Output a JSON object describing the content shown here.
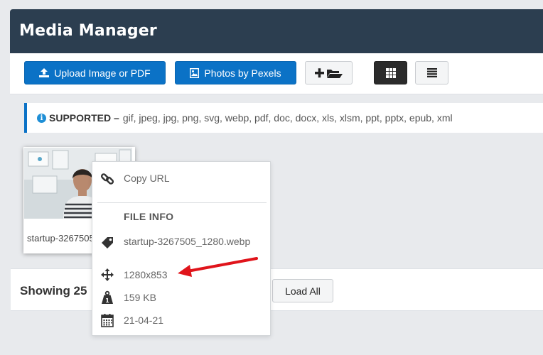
{
  "header": {
    "title": "Media Manager"
  },
  "toolbar": {
    "upload_label": "Upload Image or PDF",
    "pexels_label": "Photos by Pexels"
  },
  "notice": {
    "label": "SUPPORTED –",
    "formats": "gif, jpeg, jpg, png, svg, webp, pdf, doc, docx, xls, xlsm, ppt, pptx, epub, xml"
  },
  "media_item": {
    "name": "startup-3267505_1280.webp"
  },
  "footer": {
    "showing_label": "Showing 25",
    "load_all_label": "Load All"
  },
  "context_menu": {
    "copy_url_label": "Copy URL",
    "file_info_heading": "FILE INFO",
    "filename": "startup-3267505_1280.webp",
    "dimensions": "1280x853",
    "size": "159 KB",
    "date": "21-04-21"
  },
  "colors": {
    "header_bg": "#2c3e50",
    "primary": "#0b72c6",
    "annotation_arrow": "#e0141b"
  }
}
